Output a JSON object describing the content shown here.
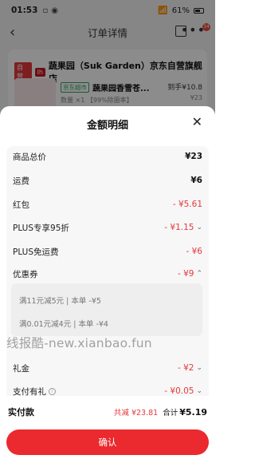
{
  "status": {
    "time": "01:53",
    "battery": "61%"
  },
  "header": {
    "title": "订单详情",
    "badge": "34"
  },
  "background": {
    "self_tag": "自营",
    "brand_tag": "lh",
    "shop_name": "蔬果园（Suk Garden）京东自营旗舰店",
    "market_tag": "京东超市",
    "product_name": "蔬果园香雪苍...",
    "price": "到手¥10.8",
    "qty": "数量 ×1   【99%除菌率】",
    "qty2": "¥23"
  },
  "sheet": {
    "title": "金额明细",
    "rows": [
      {
        "label": "商品总价",
        "value": "¥23",
        "red": false
      },
      {
        "label": "运费",
        "value": "¥6",
        "red": false
      },
      {
        "label": "红包",
        "value": "- ¥5.61",
        "red": true
      },
      {
        "label": "PLUS专享95折",
        "value": "- ¥1.15",
        "red": true
      },
      {
        "label": "PLUS免运费",
        "value": "- ¥6",
        "red": true
      },
      {
        "label": "优惠券",
        "value": "- ¥9",
        "red": true
      },
      {
        "label": "礼金",
        "value": "- ¥2",
        "red": true
      },
      {
        "label": "支付有礼",
        "value": "- ¥0.05",
        "red": true
      }
    ],
    "coupons": [
      "满11元减5元 | 本单 -¥5",
      "满0.01元减4元 | 本单 -¥4"
    ],
    "watermark": "线报酷-new.xianbao.fun"
  },
  "footer": {
    "pay_label": "实付款",
    "reduce": "共减 ¥23.81",
    "total_label": "合计",
    "total": "¥5.19",
    "confirm": "确认"
  },
  "colors": {
    "accent": "#ea2a2e",
    "discount": "#e4393c"
  }
}
